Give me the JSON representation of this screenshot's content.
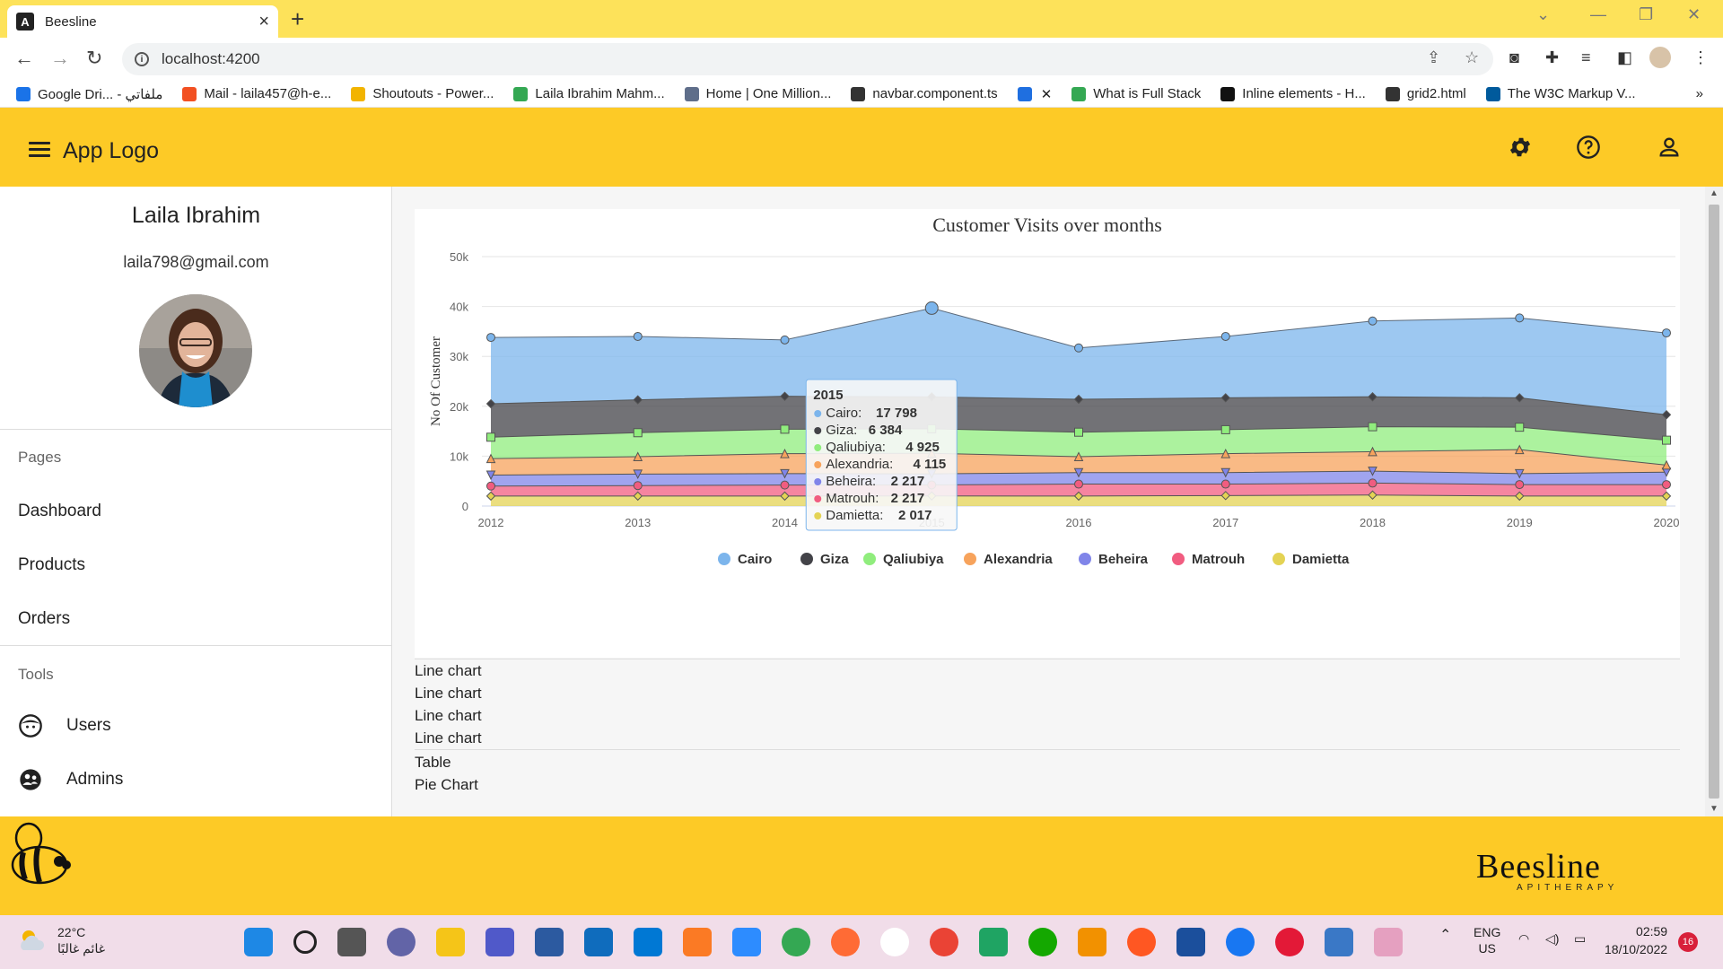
{
  "browser": {
    "tab_title": "Beesline",
    "url": "localhost:4200",
    "bookmarks": [
      {
        "label": "Google Dri... - ملفاتي",
        "color": "#1a73e8"
      },
      {
        "label": "Mail - laila457@h-e...",
        "color": "#f25022"
      },
      {
        "label": "Shoutouts - Power...",
        "color": "#f2b400"
      },
      {
        "label": "Laila Ibrahim Mahm...",
        "color": "#34a853"
      },
      {
        "label": "Home | One Million...",
        "color": "#5f6e8a"
      },
      {
        "label": "navbar.component.ts",
        "color": "#333333"
      },
      {
        "label": "",
        "color": "#1f6fe0"
      },
      {
        "label": "What is Full Stack",
        "color": "#34a853"
      },
      {
        "label": "Inline elements - H...",
        "color": "#111111"
      },
      {
        "label": "grid2.html",
        "color": "#333333"
      },
      {
        "label": "The W3C Markup V...",
        "color": "#005a9c"
      }
    ]
  },
  "header": {
    "logo_text": "App Logo"
  },
  "sidebar": {
    "user_name": "Laila Ibrahim",
    "user_email": "laila798@gmail.com",
    "pages_heading": "Pages",
    "pages": [
      "Dashboard",
      "Products",
      "Orders"
    ],
    "tools_heading": "Tools",
    "tools": [
      "Users",
      "Admins"
    ]
  },
  "main": {
    "items_group1": [
      "Line chart",
      "Line chart",
      "Line chart",
      "Line chart"
    ],
    "items_group2": [
      "Table",
      "Pie Chart"
    ]
  },
  "tooltip": {
    "title": "2015",
    "rows": [
      {
        "label": "Cairo:",
        "value": "17 798",
        "color": "#7cb5ec"
      },
      {
        "label": "Giza:",
        "value": "6 384",
        "color": "#434348"
      },
      {
        "label": "Qaliubiya:",
        "value": "4 925",
        "color": "#90ed7d"
      },
      {
        "label": "Alexandria:",
        "value": "4 115",
        "color": "#f7a35c"
      },
      {
        "label": "Beheira:",
        "value": "2 217",
        "color": "#8085e9"
      },
      {
        "label": "Matrouh:",
        "value": "2 217",
        "color": "#f15c80"
      },
      {
        "label": "Damietta:",
        "value": "2 017",
        "color": "#e4d354"
      }
    ]
  },
  "chart_data": {
    "type": "area",
    "stacked": true,
    "title": "Customer Visits over months",
    "xlabel": "",
    "ylabel": "No Of Customer",
    "ylim": [
      0,
      50000
    ],
    "yticks": [
      "0",
      "10k",
      "20k",
      "30k",
      "40k",
      "50k"
    ],
    "categories": [
      "2012",
      "2013",
      "2014",
      "2015",
      "2016",
      "2017",
      "2018",
      "2019",
      "2020"
    ],
    "grid": true,
    "legend_position": "bottom",
    "series": [
      {
        "name": "Damietta",
        "color": "#e4d354",
        "values": [
          2000,
          2000,
          2000,
          2017,
          2000,
          2100,
          2200,
          2000,
          2000
        ]
      },
      {
        "name": "Matrouh",
        "color": "#f15c80",
        "values": [
          2000,
          2100,
          2200,
          2217,
          2400,
          2300,
          2400,
          2300,
          2300
        ]
      },
      {
        "name": "Beheira",
        "color": "#8085e9",
        "values": [
          2200,
          2300,
          2300,
          2217,
          2300,
          2300,
          2400,
          2200,
          2500
        ]
      },
      {
        "name": "Alexandria",
        "color": "#f7a35c",
        "values": [
          3300,
          3500,
          4000,
          4115,
          3200,
          3800,
          3900,
          4800,
          1400
        ]
      },
      {
        "name": "Qaliubiya",
        "color": "#90ed7d",
        "values": [
          4300,
          4800,
          4900,
          4925,
          4900,
          4800,
          5000,
          4500,
          5000
        ]
      },
      {
        "name": "Giza",
        "color": "#434348",
        "values": [
          6700,
          6600,
          6600,
          6384,
          6600,
          6400,
          6000,
          5900,
          5100
        ]
      },
      {
        "name": "Cairo",
        "color": "#7cb5ec",
        "values": [
          13300,
          12700,
          11300,
          17798,
          10300,
          12300,
          15200,
          16000,
          16400
        ]
      }
    ],
    "legend_order": [
      "Cairo",
      "Giza",
      "Qaliubiya",
      "Alexandria",
      "Beheira",
      "Matrouh",
      "Damietta"
    ],
    "highlighted_category": "2015"
  },
  "footer": {
    "brand": "Beesline",
    "brand_sub": "APITHERAPY"
  },
  "taskbar": {
    "temperature": "22°C",
    "weather_text": "غائم غالبًا",
    "lang_line1": "ENG",
    "lang_line2": "US",
    "time": "02:59",
    "date": "18/10/2022",
    "notifications": "16"
  }
}
